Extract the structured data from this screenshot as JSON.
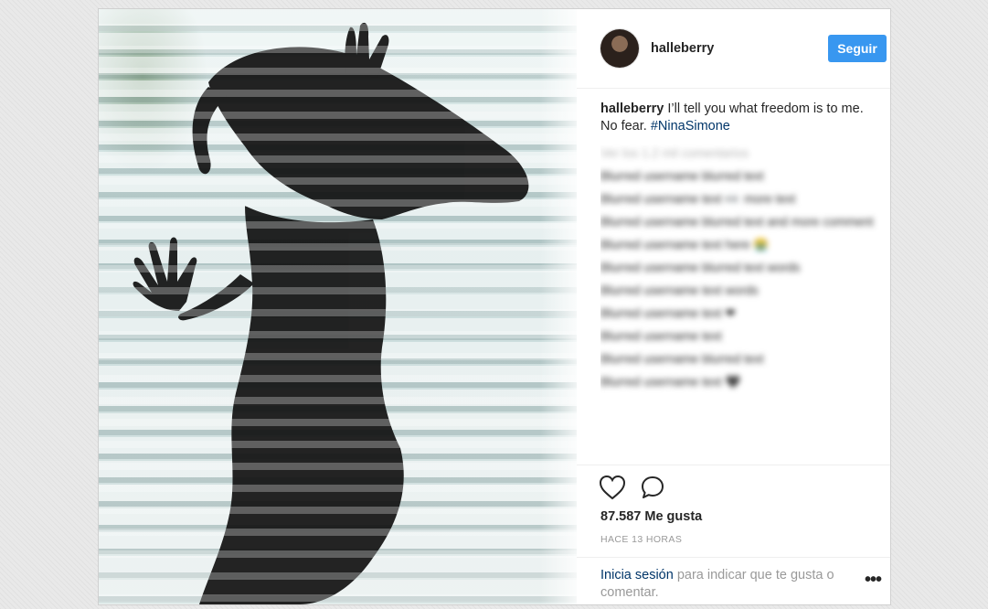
{
  "post": {
    "username": "halleberry",
    "follow_label": "Seguir",
    "caption": {
      "username": "halleberry",
      "text": " I’ll tell you what freedom is to me. No fear. ",
      "hashtag": "#NinaSimone"
    },
    "comments": [
      "Ver los 1.2 mil comentarios",
      "Blurred username blurred text",
      "Blurred username text 👀 more text",
      "Blurred username blurred text and more comment",
      "Blurred username text here 😭",
      "Blurred username blurred text words",
      "Blurred username text words",
      "Blurred username text ❤",
      "Blurred username text",
      "Blurred username blurred text",
      "Blurred username text 🖤"
    ],
    "likes": "87.587 Me gusta",
    "timestamp": "HACE 13 HORAS",
    "login_prompt": {
      "link": "Inicia sesión",
      "text": " para indicar que te gusta o comentar."
    },
    "more_label": "•••"
  },
  "icons": {
    "like": "heart-icon",
    "comment": "comment-icon",
    "more": "more-options-icon"
  },
  "colors": {
    "follow_button": "#3897f0",
    "hashtag": "#003569",
    "text": "#262626",
    "muted": "#999999"
  }
}
